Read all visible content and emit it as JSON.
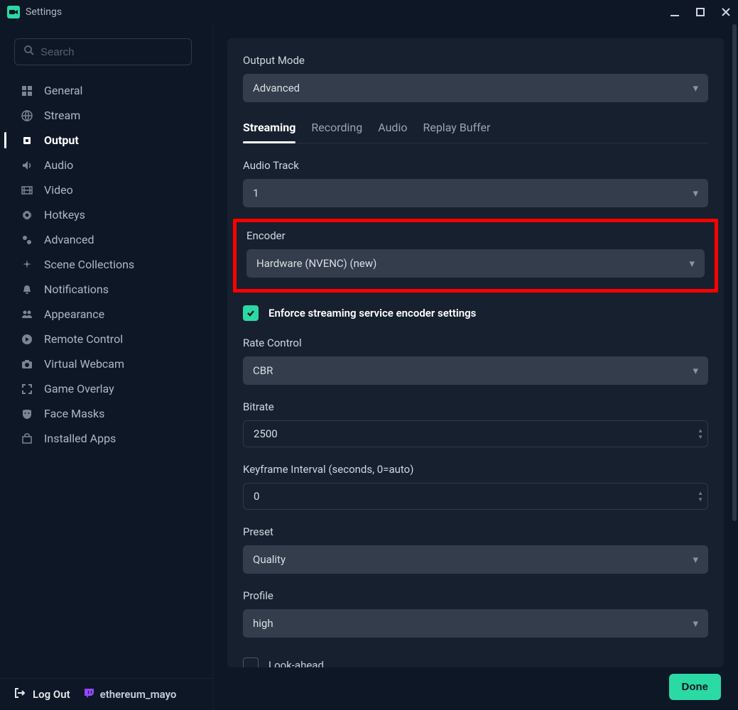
{
  "window": {
    "title": "Settings"
  },
  "search": {
    "placeholder": "Search"
  },
  "sidebar": {
    "items": [
      {
        "label": "General",
        "icon": "grid-icon"
      },
      {
        "label": "Stream",
        "icon": "globe-icon"
      },
      {
        "label": "Output",
        "icon": "cpu-icon",
        "active": true
      },
      {
        "label": "Audio",
        "icon": "speaker-icon"
      },
      {
        "label": "Video",
        "icon": "film-icon"
      },
      {
        "label": "Hotkeys",
        "icon": "gear-icon"
      },
      {
        "label": "Advanced",
        "icon": "gears-icon"
      },
      {
        "label": "Scene Collections",
        "icon": "sparkles-icon"
      },
      {
        "label": "Notifications",
        "icon": "bell-icon"
      },
      {
        "label": "Appearance",
        "icon": "people-icon"
      },
      {
        "label": "Remote Control",
        "icon": "play-circle-icon"
      },
      {
        "label": "Virtual Webcam",
        "icon": "camera-icon"
      },
      {
        "label": "Game Overlay",
        "icon": "expand-icon"
      },
      {
        "label": "Face Masks",
        "icon": "mask-icon"
      },
      {
        "label": "Installed Apps",
        "icon": "shop-icon"
      }
    ]
  },
  "sidebar_bottom": {
    "logout": "Log Out",
    "username": "ethereum_mayo"
  },
  "output": {
    "mode_label": "Output Mode",
    "mode_value": "Advanced",
    "tabs": [
      "Streaming",
      "Recording",
      "Audio",
      "Replay Buffer"
    ],
    "active_tab": "Streaming",
    "audio_track_label": "Audio Track",
    "audio_track_value": "1",
    "encoder_label": "Encoder",
    "encoder_value": "Hardware (NVENC) (new)",
    "enforce_label": "Enforce streaming service encoder settings",
    "enforce_checked": true,
    "rate_control_label": "Rate Control",
    "rate_control_value": "CBR",
    "bitrate_label": "Bitrate",
    "bitrate_value": "2500",
    "keyframe_label": "Keyframe Interval (seconds, 0=auto)",
    "keyframe_value": "0",
    "preset_label": "Preset",
    "preset_value": "Quality",
    "profile_label": "Profile",
    "profile_value": "high",
    "lookahead_label": "Look-ahead",
    "lookahead_checked": false
  },
  "footer": {
    "done": "Done"
  }
}
